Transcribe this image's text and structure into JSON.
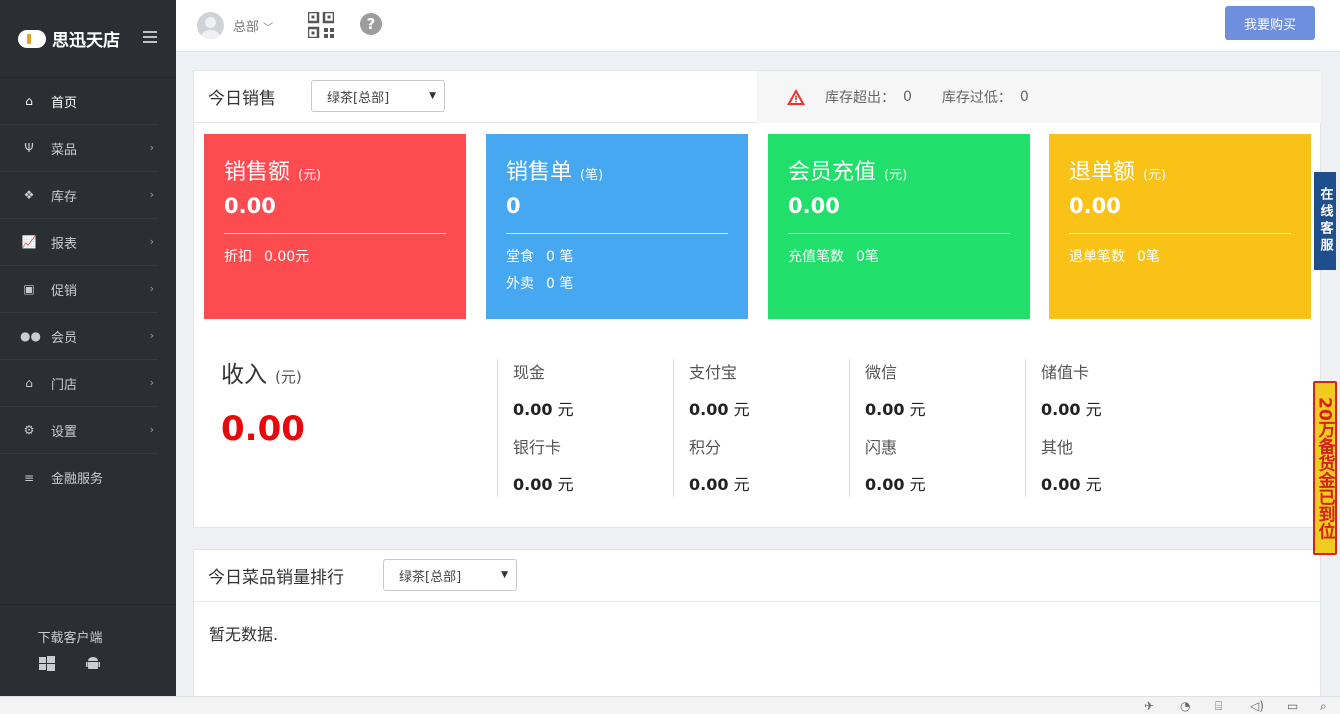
{
  "brand": {
    "name": "思迅天店"
  },
  "sidebar": {
    "items": [
      {
        "label": "首页",
        "icon": "home-icon",
        "active": true
      },
      {
        "label": "菜品",
        "icon": "utensils-icon"
      },
      {
        "label": "库存",
        "icon": "cubes-icon"
      },
      {
        "label": "报表",
        "icon": "line-chart-icon"
      },
      {
        "label": "促销",
        "icon": "gift-icon"
      },
      {
        "label": "会员",
        "icon": "users-icon"
      },
      {
        "label": "门店",
        "icon": "bank-icon"
      },
      {
        "label": "设置",
        "icon": "gear-icon"
      },
      {
        "label": "金融服务",
        "icon": "database-icon"
      }
    ],
    "download_label": "下载客户端"
  },
  "topbar": {
    "user": "总部",
    "buy_label": "我要购买"
  },
  "sales_panel": {
    "title": "今日销售",
    "store_select": "绿茶[总部]",
    "stock_over_label": "库存超出：",
    "stock_over_value": "0",
    "stock_low_label": "库存过低：",
    "stock_low_value": "0"
  },
  "cards": [
    {
      "title": "销售额",
      "unit": "(元)",
      "value": "0.00",
      "color": "#fc4c50",
      "sub1_label": "折扣",
      "sub1_value": "0.00元"
    },
    {
      "title": "销售单",
      "unit": "(笔)",
      "value": "0",
      "color": "#47a8f2",
      "sub1_label": "堂食",
      "sub1_value": "0 笔",
      "sub2_label": "外卖",
      "sub2_value": "0 笔"
    },
    {
      "title": "会员充值",
      "unit": "(元)",
      "value": "0.00",
      "color": "#21df6b",
      "sub1_label": "充值笔数",
      "sub1_value": "0笔"
    },
    {
      "title": "退单额",
      "unit": "(元)",
      "value": "0.00",
      "color": "#fac217",
      "sub1_label": "退单笔数",
      "sub1_value": "0笔"
    }
  ],
  "income": {
    "title": "收入",
    "unit": "(元)",
    "value": "0.00",
    "columns": [
      {
        "label1": "现金",
        "amount1": "0.00",
        "label2": "银行卡",
        "amount2": "0.00"
      },
      {
        "label1": "支付宝",
        "amount1": "0.00",
        "label2": "积分",
        "amount2": "0.00"
      },
      {
        "label1": "微信",
        "amount1": "0.00",
        "label2": "闪惠",
        "amount2": "0.00"
      },
      {
        "label1": "储值卡",
        "amount1": "0.00",
        "label2": "其他",
        "amount2": "0.00"
      }
    ],
    "currency": "元"
  },
  "ranking_panel": {
    "title": "今日菜品销量排行",
    "store_select": "绿茶[总部]",
    "empty_text": "暂无数据."
  },
  "floating": {
    "customer_service": "在线客服",
    "promo": "20万备货金已到位"
  }
}
